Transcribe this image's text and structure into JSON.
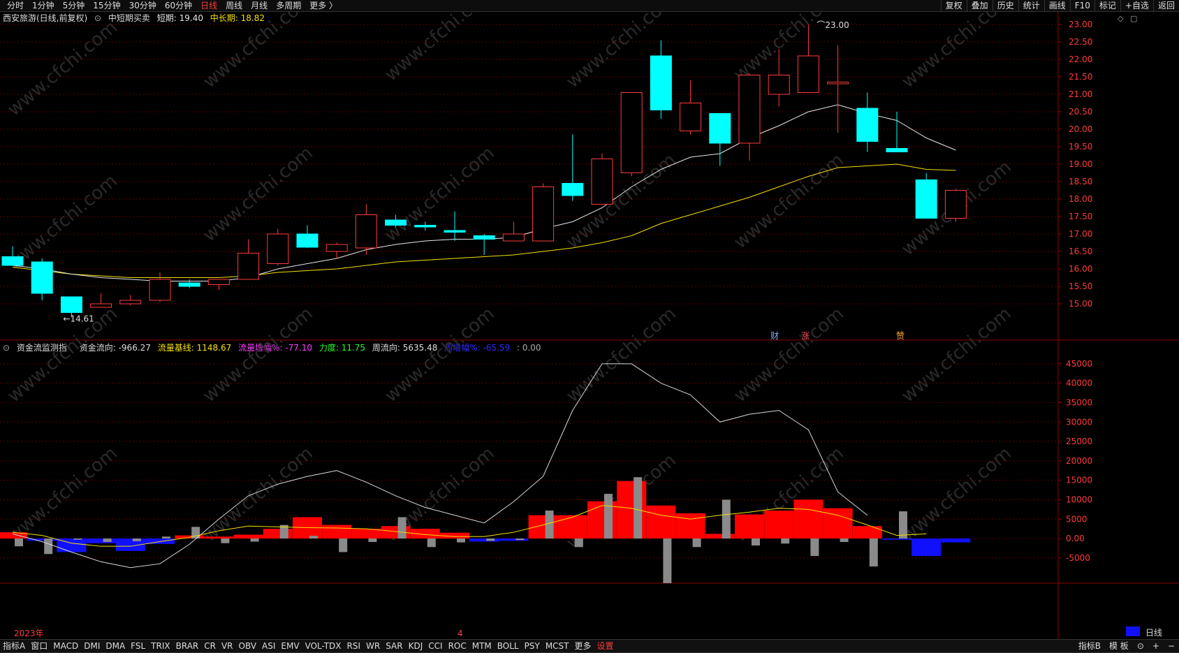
{
  "topbar": {
    "periods": [
      "分时",
      "1分钟",
      "5分钟",
      "15分钟",
      "30分钟",
      "60分钟",
      "日线",
      "周线",
      "月线",
      "多周期",
      "更多 〉"
    ],
    "active_period": "日线",
    "tools": [
      "复权",
      "叠加",
      "历史",
      "统计",
      "画线",
      "F10",
      "标记",
      "+自选",
      "返回"
    ]
  },
  "main_legend": {
    "title": "西安旅游(日线,前复权)",
    "indicator": "中短期买卖",
    "short_label": "短期: 19.40",
    "long_label": "中长期: 18.82"
  },
  "sub_legend": {
    "title": "资金流监测指",
    "flow_dir": "资金流向: -966.27",
    "baseline": "流量基线: 1148.67",
    "increase": "流量增幅%: -77.10",
    "strength": "力度: 11.75",
    "week_flow": "周流向: 5635.48",
    "week_inc": "周增幅%: -65.59",
    "extra": ": 0.00"
  },
  "annotations": {
    "high": "23.00",
    "low": "14.61",
    "event1": "财",
    "event2": "涨",
    "event3": "赞"
  },
  "x_labels": {
    "year": "2023年",
    "month": "4"
  },
  "price_axis": [
    "23.00",
    "22.50",
    "22.00",
    "21.50",
    "21.00",
    "20.50",
    "20.00",
    "19.50",
    "19.00",
    "18.50",
    "18.00",
    "17.50",
    "17.00",
    "16.50",
    "16.00",
    "15.50",
    "15.00"
  ],
  "flow_axis": [
    "45000",
    "40000",
    "35000",
    "30000",
    "25000",
    "20000",
    "15000",
    "10000",
    "5000",
    "0.00",
    "-5000"
  ],
  "watermark": "www.cfchi.com",
  "bottombar": {
    "tabs": [
      "指标A",
      "窗口",
      "MACD",
      "DMI",
      "DMA",
      "FSL",
      "TRIX",
      "BRAR",
      "CR",
      "VR",
      "OBV",
      "ASI",
      "EMV",
      "VOL-TDX",
      "RSI",
      "WR",
      "SAR",
      "KDJ",
      "CCI",
      "ROC",
      "MTM",
      "BOLL",
      "PSY",
      "MCST",
      "更多",
      "设置"
    ],
    "right": [
      "指标B",
      "模 板",
      "⊙",
      "+",
      "−"
    ],
    "period": "日线"
  },
  "colors": {
    "up": "#ff3b3b",
    "down": "#00ffff",
    "short_ma": "#e6e6e6",
    "long_ma": "#f5e000",
    "pos_flow": "#ff0000",
    "neg_flow": "#1010ff",
    "grey": "#8a8a8a"
  },
  "chart_data": {
    "type": "candlestick",
    "price_range": [
      14.3,
      23.2
    ],
    "candles": [
      {
        "o": 16.35,
        "h": 16.65,
        "l": 16.1,
        "c": 16.1
      },
      {
        "o": 16.2,
        "h": 16.3,
        "l": 15.1,
        "c": 15.3
      },
      {
        "o": 15.2,
        "h": 15.2,
        "l": 14.61,
        "c": 14.75
      },
      {
        "o": 14.9,
        "h": 15.3,
        "l": 14.9,
        "c": 15.0
      },
      {
        "o": 15.0,
        "h": 15.25,
        "l": 14.95,
        "c": 15.1
      },
      {
        "o": 15.1,
        "h": 15.9,
        "l": 15.05,
        "c": 15.7
      },
      {
        "o": 15.6,
        "h": 15.7,
        "l": 15.45,
        "c": 15.5
      },
      {
        "o": 15.55,
        "h": 15.7,
        "l": 15.4,
        "c": 15.7
      },
      {
        "o": 15.7,
        "h": 16.85,
        "l": 15.7,
        "c": 16.45
      },
      {
        "o": 16.15,
        "h": 17.15,
        "l": 16.1,
        "c": 17.0
      },
      {
        "o": 17.0,
        "h": 17.25,
        "l": 16.6,
        "c": 16.62
      },
      {
        "o": 16.5,
        "h": 16.75,
        "l": 16.3,
        "c": 16.7
      },
      {
        "o": 16.6,
        "h": 17.85,
        "l": 16.4,
        "c": 17.55
      },
      {
        "o": 17.4,
        "h": 17.55,
        "l": 17.2,
        "c": 17.25
      },
      {
        "o": 17.25,
        "h": 17.35,
        "l": 17.1,
        "c": 17.2
      },
      {
        "o": 17.1,
        "h": 17.65,
        "l": 16.8,
        "c": 17.05
      },
      {
        "o": 16.95,
        "h": 17.0,
        "l": 16.4,
        "c": 16.85
      },
      {
        "o": 16.8,
        "h": 17.35,
        "l": 16.8,
        "c": 17.0
      },
      {
        "o": 16.8,
        "h": 18.45,
        "l": 16.8,
        "c": 18.35
      },
      {
        "o": 18.45,
        "h": 19.85,
        "l": 17.95,
        "c": 18.1
      },
      {
        "o": 17.85,
        "h": 19.3,
        "l": 17.85,
        "c": 19.15
      },
      {
        "o": 18.75,
        "h": 21.05,
        "l": 18.65,
        "c": 21.05
      },
      {
        "o": 22.1,
        "h": 22.55,
        "l": 20.3,
        "c": 20.55
      },
      {
        "o": 19.95,
        "h": 21.4,
        "l": 19.85,
        "c": 20.75
      },
      {
        "o": 20.45,
        "h": 20.45,
        "l": 18.95,
        "c": 19.6
      },
      {
        "o": 19.6,
        "h": 21.6,
        "l": 19.1,
        "c": 21.55
      },
      {
        "o": 21.0,
        "h": 22.3,
        "l": 20.65,
        "c": 21.55
      },
      {
        "o": 21.05,
        "h": 23.0,
        "l": 21.05,
        "c": 22.1
      },
      {
        "o": 21.3,
        "h": 22.4,
        "l": 19.9,
        "c": 21.35
      },
      {
        "o": 20.6,
        "h": 21.05,
        "l": 19.35,
        "c": 19.65
      },
      {
        "o": 19.45,
        "h": 20.5,
        "l": 19.35,
        "c": 19.35
      },
      {
        "o": 18.55,
        "h": 18.75,
        "l": 17.45,
        "c": 17.45
      },
      {
        "o": 17.45,
        "h": 18.3,
        "l": 17.35,
        "c": 18.25
      }
    ],
    "short_ma": [
      16.1,
      16.0,
      15.85,
      15.75,
      15.7,
      15.65,
      15.65,
      15.65,
      15.75,
      16.0,
      16.15,
      16.3,
      16.55,
      16.7,
      16.8,
      16.85,
      16.85,
      16.9,
      17.15,
      17.35,
      17.75,
      18.35,
      18.85,
      19.2,
      19.3,
      19.75,
      20.1,
      20.5,
      20.7,
      20.45,
      20.25,
      19.75,
      19.4
    ],
    "long_ma": [
      16.05,
      15.95,
      15.85,
      15.8,
      15.75,
      15.75,
      15.75,
      15.75,
      15.8,
      15.9,
      15.95,
      16.0,
      16.1,
      16.2,
      16.25,
      16.3,
      16.35,
      16.4,
      16.5,
      16.6,
      16.75,
      16.95,
      17.3,
      17.55,
      17.8,
      18.05,
      18.35,
      18.65,
      18.9,
      18.95,
      19.0,
      18.85,
      18.82
    ],
    "flow_range": [
      -11500,
      47500
    ],
    "flow_bars": [
      1600,
      -600,
      -3500,
      -1200,
      -3200,
      -1400,
      800,
      500,
      1000,
      2500,
      5500,
      3500,
      2500,
      3200,
      2500,
      1500,
      -800,
      -600,
      6000,
      6000,
      9600,
      14800,
      8500,
      6500,
      1200,
      6200,
      7200,
      10000,
      7800,
      3200,
      -300,
      -4500,
      -1000
    ],
    "grey_bars": [
      -2000,
      -4000,
      -300,
      -900,
      -700,
      500,
      3000,
      -1200,
      -800,
      3500,
      700,
      -3500,
      -900,
      5500,
      -2200,
      -1000,
      -600,
      -400,
      7200,
      -2200,
      11500,
      15800,
      -11500,
      -2200,
      10000,
      -1800,
      -1300,
      -4500,
      -900,
      -7200,
      7000
    ],
    "flow_line": [
      1200,
      -800,
      -3500,
      -6000,
      -7500,
      -6500,
      -1500,
      5000,
      11000,
      14000,
      16000,
      17500,
      14500,
      11000,
      8000,
      6000,
      4000,
      9500,
      16000,
      33000,
      45000,
      45000,
      40000,
      37000,
      30000,
      32000,
      33000,
      28000,
      12000,
      6000
    ],
    "flow_ma": [
      1600,
      800,
      -1200,
      -2000,
      -2000,
      -800,
      300,
      2000,
      3200,
      3000,
      2800,
      2700,
      2500,
      1800,
      1000,
      500,
      500,
      1600,
      3500,
      5500,
      8500,
      7800,
      6000,
      5000,
      6000,
      6800,
      7800,
      7500,
      6000,
      3500,
      800,
      1200
    ]
  }
}
